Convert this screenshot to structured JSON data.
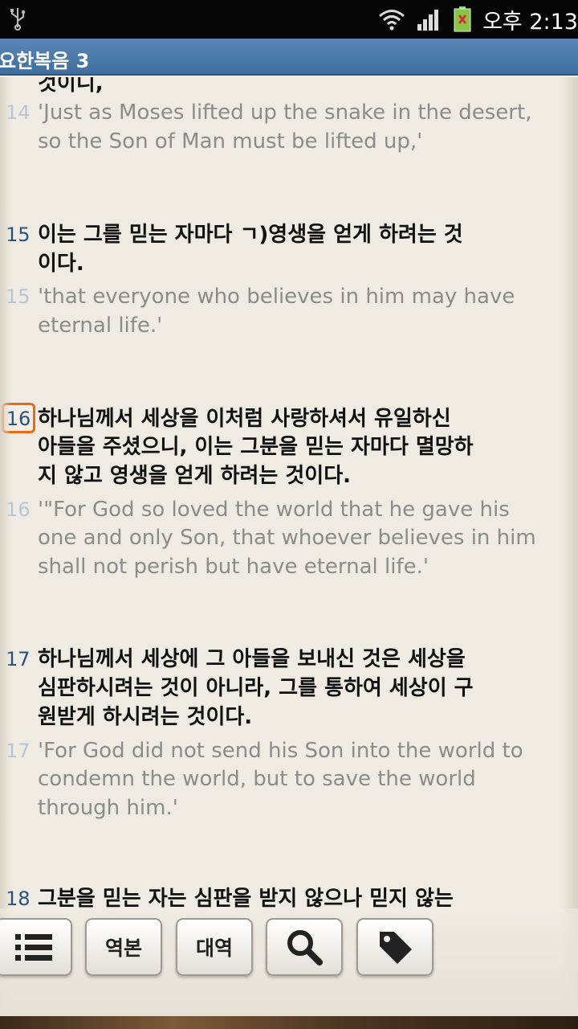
{
  "status_bar": {
    "time": "오후 2:13",
    "icons": [
      "usb-icon",
      "wifi-icon",
      "signal-icon",
      "battery-icon"
    ]
  },
  "header": {
    "title": "요한복음 3"
  },
  "passage": {
    "top_fragment": "것이니,",
    "verses": [
      {
        "number": "14",
        "english": [
          "'Just as Moses lifted up the snake in the desert,",
          "so the Son of Man must be lifted up,'"
        ]
      },
      {
        "number": "15",
        "korean": [
          "이는 그를 믿는 자마다 ㄱ)영생을 얻게 하려는 것",
          "이다."
        ],
        "english": [
          "'that everyone who believes in him may have",
          "eternal life.'"
        ]
      },
      {
        "number": "16",
        "selected": true,
        "korean": [
          "하나님께서 세상을 이처럼 사랑하셔서 유일하신",
          "아들을 주셨으니, 이는 그분을 믿는 자마다 멸망하",
          "지 않고 영생을 얻게 하려는 것이다."
        ],
        "english": [
          "'\"For God so loved the world that he gave his",
          "one and only Son, that whoever believes in him",
          "shall not perish but have eternal life.'"
        ]
      },
      {
        "number": "17",
        "korean": [
          "하나님께서 세상에 그 아들을 보내신 것은 세상을",
          "심판하시려는 것이 아니라, 그를 통하여 세상이 구",
          "원받게 하시려는 것이다."
        ],
        "english": [
          "'For God did not send his Son into the world to",
          "condemn the world, but to save the world",
          "through him.'"
        ]
      },
      {
        "number": "18",
        "korean": [
          "그분을 믿는 자는 심판을 받지 않으나 믿지 않는"
        ]
      }
    ]
  },
  "toolbar": {
    "buttons": [
      {
        "name": "list",
        "icon": "list-icon"
      },
      {
        "name": "version",
        "label": "역본"
      },
      {
        "name": "parallel",
        "label": "대역"
      },
      {
        "name": "search",
        "icon": "search-icon"
      },
      {
        "name": "tag",
        "icon": "tag-icon"
      }
    ]
  },
  "colors": {
    "status_bar": "#050505",
    "title_bar": "#4a7aab",
    "page_bg": "#efebe2",
    "korean_number": "#29527d",
    "english_number": "#b5c6d8",
    "english_text": "#8b8b8b",
    "selection_border": "#e86a12"
  }
}
